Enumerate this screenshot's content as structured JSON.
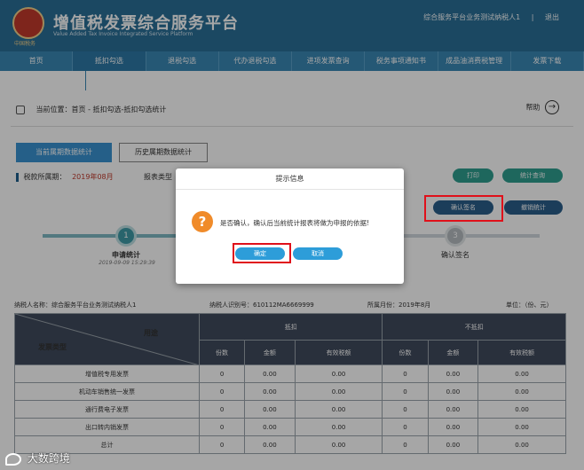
{
  "header": {
    "title": "增值税发票综合服务平台",
    "subtitle": "Value Added Tax Invoice Integrated Service Platform",
    "logo_text": "中国税务",
    "user_name": "综合服务平台业务测试纳税人1",
    "logout": "退出"
  },
  "nav": {
    "items": [
      "首页",
      "抵扣勾选",
      "退税勾选",
      "代办退税勾选",
      "进项发票查询",
      "税务事项通知书",
      "成品油消费税管理",
      "发票下载"
    ],
    "active_index": 1
  },
  "breadcrumb": {
    "text": "当前位置：首页 - 抵扣勾选-抵扣勾选统计",
    "help": "帮助",
    "help_icon": "arrow-right-circle-icon"
  },
  "tabs": {
    "current": "当前属期数据统计",
    "history": "历史属期数据统计"
  },
  "period": {
    "label": "税款所属期：",
    "value": "2019年08月",
    "report_type_label": "报表类型"
  },
  "buttons": {
    "print": "打印",
    "stat_query": "统计查询",
    "confirm_sign": "确认签名",
    "revoke_stat": "撤销统计"
  },
  "steps": {
    "step1_num": "1",
    "step1_label": "申请统计",
    "step1_time": "2019-09-09 15:29:39",
    "step3_num": "3",
    "step3_label": "确认签名"
  },
  "taxpayer": {
    "name": "纳税人名称：综合服务平台业务测试纳税人1",
    "id": "纳税人识别号：610112MA6669999",
    "month": "所属月份：2019年8月",
    "unit": "单位：（份、元）"
  },
  "table": {
    "diag_left": "发票类型",
    "diag_right": "用途",
    "group_deduct": "抵扣",
    "group_nondeduct": "不抵扣",
    "cols": [
      "份数",
      "金额",
      "有效税额",
      "份数",
      "金额",
      "有效税额"
    ],
    "rows": [
      {
        "type": "增值税专用发票",
        "vals": [
          "0",
          "0.00",
          "0.00",
          "0",
          "0.00",
          "0.00"
        ]
      },
      {
        "type": "机动车销售统一发票",
        "vals": [
          "0",
          "0.00",
          "0.00",
          "0",
          "0.00",
          "0.00"
        ]
      },
      {
        "type": "通行费电子发票",
        "vals": [
          "0",
          "0.00",
          "0.00",
          "0",
          "0.00",
          "0.00"
        ]
      },
      {
        "type": "出口转内销发票",
        "vals": [
          "0",
          "0.00",
          "0.00",
          "0",
          "0.00",
          "0.00"
        ]
      },
      {
        "type": "总计",
        "vals": [
          "0",
          "0.00",
          "0.00",
          "0",
          "0.00",
          "0.00"
        ]
      }
    ]
  },
  "modal": {
    "title": "提示信息",
    "icon": "question-icon",
    "icon_glyph": "?",
    "message": "是否确认，确认后当前统计报表将做为申报的依据!",
    "ok": "确定",
    "cancel": "取消"
  },
  "watermark": "大数跨境",
  "colors": {
    "header_bg": "#2a6f97",
    "nav_bg": "#3987b4",
    "highlight_red": "#e0101a",
    "modal_button": "#2d9dd9",
    "warn_icon": "#f08b2a",
    "table_header": "#3f4a5c"
  }
}
